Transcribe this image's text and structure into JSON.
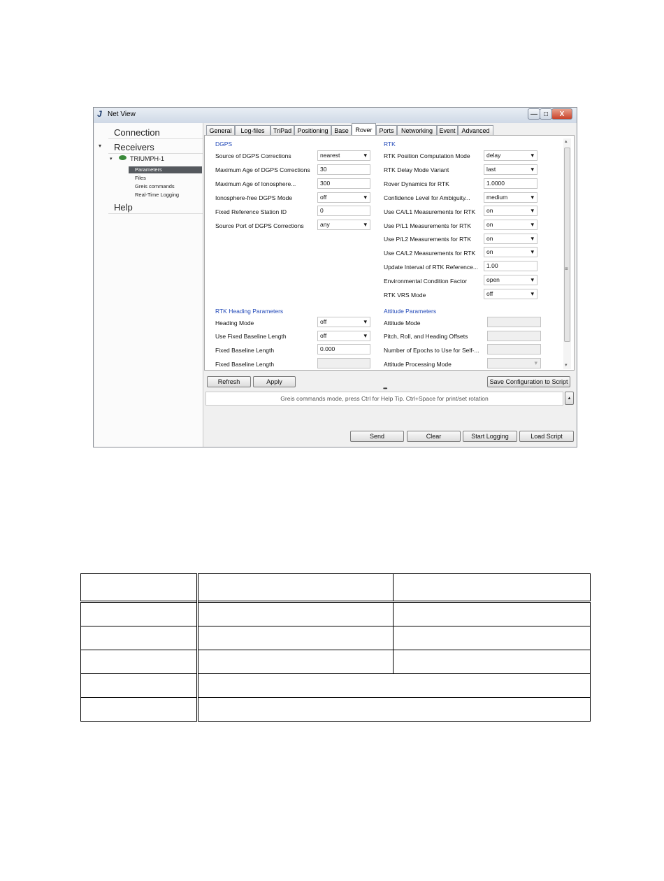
{
  "window": {
    "title": "Net View",
    "controls": {
      "minimize": "—",
      "maximize": "□",
      "close": "X"
    }
  },
  "sidebar": {
    "items": [
      {
        "label": "Connection"
      },
      {
        "label": "Receivers"
      },
      {
        "label": "Help"
      }
    ],
    "receiver": {
      "label": "TRIUMPH-1"
    },
    "receiver_items": [
      {
        "label": "Parameters",
        "selected": true
      },
      {
        "label": "Files"
      },
      {
        "label": "Greis commands"
      },
      {
        "label": "Real-Time Logging"
      }
    ]
  },
  "tabs": [
    {
      "label": "General"
    },
    {
      "label": "Log-files"
    },
    {
      "label": "TriPad"
    },
    {
      "label": "Positioning"
    },
    {
      "label": "Base"
    },
    {
      "label": "Rover",
      "active": true
    },
    {
      "label": "Ports"
    },
    {
      "label": "Networking"
    },
    {
      "label": "Event"
    },
    {
      "label": "Advanced"
    }
  ],
  "dgps": {
    "title": "DGPS",
    "rows": [
      {
        "label": "Source of DGPS Corrections",
        "value": "nearest",
        "type": "dropdown"
      },
      {
        "label": "Maximum Age of DGPS Corrections",
        "value": "30",
        "type": "text"
      },
      {
        "label": "Maximum Age of Ionosphere...",
        "value": "300",
        "type": "text"
      },
      {
        "label": "Ionosphere-free DGPS Mode",
        "value": "off",
        "type": "dropdown"
      },
      {
        "label": "Fixed Reference Station ID",
        "value": "0",
        "type": "text"
      },
      {
        "label": "Source Port of DGPS Corrections",
        "value": "any",
        "type": "dropdown"
      }
    ]
  },
  "rtk": {
    "title": "RTK",
    "rows": [
      {
        "label": "RTK Position Computation Mode",
        "value": "delay",
        "type": "dropdown"
      },
      {
        "label": "RTK Delay Mode Variant",
        "value": "last",
        "type": "dropdown"
      },
      {
        "label": "Rover Dynamics for RTK",
        "value": "1.0000",
        "type": "text"
      },
      {
        "label": "Confidence Level for Ambiguity...",
        "value": "medium",
        "type": "dropdown"
      },
      {
        "label": "Use CA/L1 Measurements for RTK",
        "value": "on",
        "type": "dropdown"
      },
      {
        "label": "Use P/L1 Measurements for RTK",
        "value": "on",
        "type": "dropdown"
      },
      {
        "label": "Use P/L2 Measurements for RTK",
        "value": "on",
        "type": "dropdown"
      },
      {
        "label": "Use CA/L2 Measurements for RTK",
        "value": "on",
        "type": "dropdown"
      },
      {
        "label": "Update Interval of RTK Reference...",
        "value": "1.00",
        "type": "text"
      },
      {
        "label": "Environmental Condition Factor",
        "value": "open",
        "type": "dropdown"
      },
      {
        "label": "RTK VRS Mode",
        "value": "off",
        "type": "dropdown"
      }
    ]
  },
  "heading": {
    "title": "RTK Heading Parameters",
    "rows": [
      {
        "label": "Heading Mode",
        "value": "off",
        "type": "dropdown"
      },
      {
        "label": "Use Fixed Baseline Length",
        "value": "off",
        "type": "dropdown"
      },
      {
        "label": "Fixed Baseline Length",
        "value": "0.000",
        "type": "text"
      },
      {
        "label": "Fixed Baseline Length",
        "value": "",
        "type": "disabled"
      }
    ]
  },
  "attitude": {
    "title": "Attitude Parameters",
    "rows": [
      {
        "label": "Attitude Mode",
        "value": "",
        "type": "disabled"
      },
      {
        "label": "Pitch, Roll, and Heading Offsets",
        "value": "",
        "type": "disabled"
      },
      {
        "label": "Number of Epochs to Use for Self-...",
        "value": "",
        "type": "disabled"
      },
      {
        "label": "Attitude Processing Mode",
        "value": "",
        "type": "disabled-dropdown"
      }
    ]
  },
  "buttons": {
    "refresh": "Refresh",
    "apply": "Apply",
    "save_config": "Save Configuration to Script",
    "send": "Send",
    "clear": "Clear",
    "start_logging": "Start Logging",
    "load_script": "Load Script"
  },
  "status": {
    "message": "Greis commands mode, press Ctrl for Help Tip. Ctrl+Space for print/set rotation",
    "splitter": "•••"
  }
}
